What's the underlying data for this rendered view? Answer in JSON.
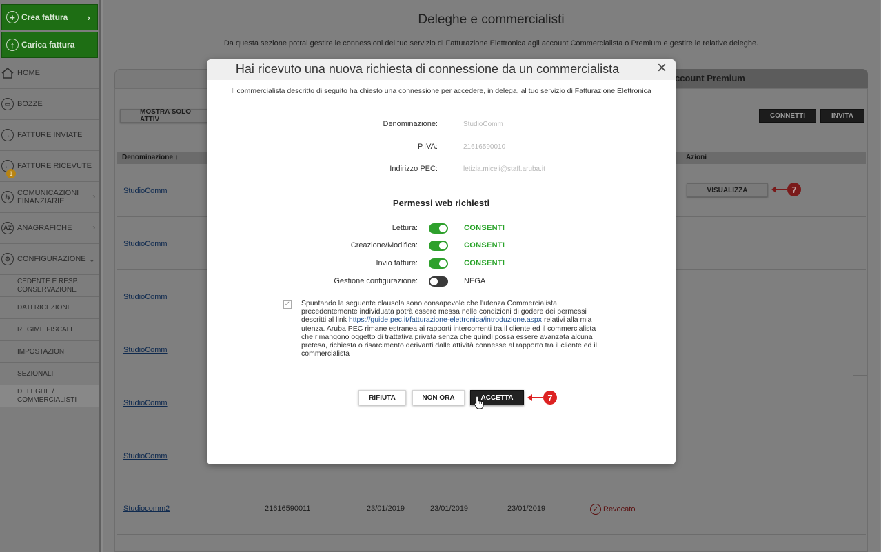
{
  "sidebar": {
    "create_invoice": "Crea fattura",
    "upload_invoice": "Carica fattura",
    "items": [
      {
        "label": "HOME"
      },
      {
        "label": "BOZZE"
      },
      {
        "label": "FATTURE INVIATE"
      },
      {
        "label": "FATTURE RICEVUTE",
        "badge": "1"
      },
      {
        "label": "COMUNICAZIONI\nFINANZIARIE"
      },
      {
        "label": "ANAGRAFICHE"
      },
      {
        "label": "CONFIGURAZIONE"
      }
    ],
    "sub_items": [
      {
        "label": "CEDENTE E RESP.\nCONSERVAZIONE"
      },
      {
        "label": "DATI RICEZIONE"
      },
      {
        "label": "REGIME FISCALE"
      },
      {
        "label": "IMPOSTAZIONI"
      },
      {
        "label": "SEZIONALI"
      },
      {
        "label": "DELEGHE /\nCOMMERCIALISTI"
      }
    ]
  },
  "page": {
    "title": "Deleghe e commercialisti",
    "description": "Da questa sezione potrai gestire le connessioni del tuo servizio di Fatturazione Elettronica agli account Commercialista o Premium e gestire le relative deleghe.",
    "tab_right": "ccount Premium",
    "filter_button": "MOSTRA SOLO ATTIV",
    "connect_button": "CONNETTI",
    "invite_button": "INVITA",
    "table": {
      "col_name": "Denominazione ↑",
      "col_actions": "Azioni",
      "rows": [
        {
          "name": "StudioComm",
          "action": "VISUALIZZA"
        },
        {
          "name": "StudioComm"
        },
        {
          "name": "StudioComm"
        },
        {
          "name": "StudioComm"
        },
        {
          "name": "StudioComm"
        },
        {
          "name": "StudioComm"
        },
        {
          "name": "Studiocomm2",
          "piva": "21616590011",
          "date1": "23/01/2019",
          "date2": "23/01/2019",
          "date3": "23/01/2019",
          "status": "Revocato"
        }
      ]
    },
    "callout_number": "7"
  },
  "modal": {
    "title": "Hai ricevuto una nuova richiesta di connessione da un commercialista",
    "close": "×",
    "intro": "Il commercialista descritto di seguito ha chiesto una connessione per accedere, in delega, al tuo servizio di Fatturazione Elettronica",
    "fields": [
      {
        "label": "Denominazione:",
        "value": "StudioComm"
      },
      {
        "label": "P.IVA:",
        "value": "21616590010"
      },
      {
        "label": "Indirizzo PEC:",
        "value": "letizia.miceli@staff.aruba.it"
      }
    ],
    "permissions_title": "Permessi web richiesti",
    "permissions": [
      {
        "label": "Lettura:",
        "state": "CONSENTI",
        "on": true
      },
      {
        "label": "Creazione/Modifica:",
        "state": "CONSENTI",
        "on": true
      },
      {
        "label": "Invio fatture:",
        "state": "CONSENTI",
        "on": true
      },
      {
        "label": "Gestione configurazione:",
        "state": "NEGA",
        "on": false
      }
    ],
    "clause_text_1": "Spuntando la seguente clausola sono consapevole che l'utenza Commercialista precedentemente individuata potrà essere messa nelle condizioni di godere dei permessi descritti al link ",
    "clause_link": "https://guide.pec.it/fatturazione-elettronica/introduzione.aspx",
    "clause_text_2": " relativi alla mia utenza. Aruba PEC rimane estranea ai rapporti intercorrenti tra il cliente ed il commercialista che rimangono oggetto di trattativa privata senza che quindi possa essere avanzata alcuna pretesa, richiesta o risarcimento derivanti dalle attività connesse al rapporto tra il cliente ed il commercialista",
    "buttons": {
      "reject": "RIFIUTA",
      "not_now": "NON ORA",
      "accept": "ACCETTA"
    },
    "callout_number": "7"
  }
}
